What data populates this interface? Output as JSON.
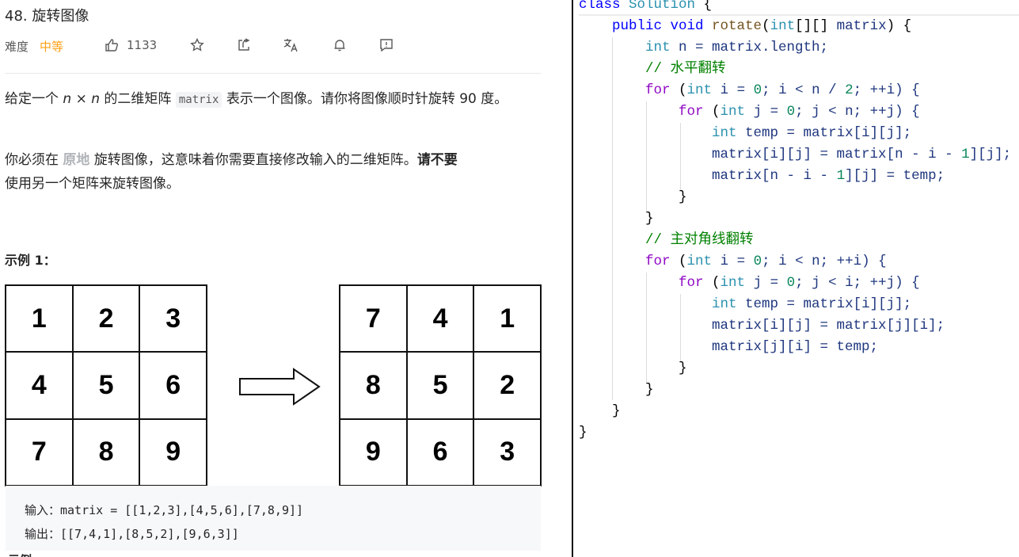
{
  "problem": {
    "title": "48. 旋转图像",
    "difficulty_label": "难度",
    "difficulty": "中等",
    "likes": "1133",
    "icons": [
      "thumbs-up-icon",
      "star-icon",
      "share-icon",
      "translate-icon",
      "bell-icon",
      "feedback-icon"
    ],
    "desc1_a": "给定一个 ",
    "desc1_n1": "n",
    "desc1_x": " × ",
    "desc1_n2": "n",
    "desc1_b": " 的二维矩阵 ",
    "desc1_code": "matrix",
    "desc1_c": " 表示一个图像。请你将图像顺时针旋转 90 度。",
    "desc2_a": "你必须在 ",
    "desc2_link": "原地",
    "desc2_b": " 旋转图像，这意味着你需要直接修改输入的二维矩阵。",
    "desc2_bold": "请不要",
    "desc2_c": "使用另一个矩阵来旋转图像。",
    "example_title": "示例 1：",
    "input_grid": [
      "1",
      "2",
      "3",
      "4",
      "5",
      "6",
      "7",
      "8",
      "9"
    ],
    "output_grid": [
      "7",
      "4",
      "1",
      "8",
      "5",
      "2",
      "9",
      "6",
      "3"
    ],
    "example_input": "输入：matrix = [[1,2,3],[4,5,6],[7,8,9]]",
    "example_output": "输出：[[7,4,1],[8,5,2],[9,6,3]]",
    "next_example_cut": "示例"
  },
  "code_lines": [
    [
      [
        "class ",
        "k"
      ],
      [
        "Solution ",
        "t"
      ],
      [
        "{",
        "pn"
      ]
    ],
    [
      [
        "    public ",
        "k"
      ],
      [
        "void ",
        "k"
      ],
      [
        "rotate",
        "m"
      ],
      [
        "(",
        "pn"
      ],
      [
        "int",
        "t"
      ],
      [
        "[][] ",
        "pn"
      ],
      [
        "matrix",
        ""
      ],
      [
        ") {",
        "pn"
      ]
    ],
    [
      [
        "        int ",
        "t"
      ],
      [
        "n = matrix.length;",
        ""
      ]
    ],
    [
      [
        "        // 水平翻转",
        "c"
      ]
    ],
    [
      [
        "        for ",
        "f"
      ],
      [
        "(",
        "pn"
      ],
      [
        "int ",
        "t"
      ],
      [
        "i = ",
        ""
      ],
      [
        "0",
        "n"
      ],
      [
        "; i < n / ",
        ""
      ],
      [
        "2",
        "n"
      ],
      [
        "; ++i) {",
        ""
      ]
    ],
    [
      [
        "            for ",
        "f"
      ],
      [
        "(",
        "pn"
      ],
      [
        "int ",
        "t"
      ],
      [
        "j = ",
        ""
      ],
      [
        "0",
        "n"
      ],
      [
        "; j < n; ++j) {",
        ""
      ]
    ],
    [
      [
        "                int ",
        "t"
      ],
      [
        "temp = matrix[i][j];",
        ""
      ]
    ],
    [
      [
        "                matrix[i][j] = matrix[n - i - ",
        ""
      ],
      [
        "1",
        "n"
      ],
      [
        "][j];",
        ""
      ]
    ],
    [
      [
        "                matrix[n - i - ",
        ""
      ],
      [
        "1",
        "n"
      ],
      [
        "][j] = temp;",
        ""
      ]
    ],
    [
      [
        "            }",
        "pn"
      ]
    ],
    [
      [
        "        }",
        "pn"
      ]
    ],
    [
      [
        "        // 主对角线翻转",
        "c"
      ]
    ],
    [
      [
        "        for ",
        "f"
      ],
      [
        "(",
        "pn"
      ],
      [
        "int ",
        "t"
      ],
      [
        "i = ",
        ""
      ],
      [
        "0",
        "n"
      ],
      [
        "; i < n; ++i) {",
        ""
      ]
    ],
    [
      [
        "            for ",
        "f"
      ],
      [
        "(",
        "pn"
      ],
      [
        "int ",
        "t"
      ],
      [
        "j = ",
        ""
      ],
      [
        "0",
        "n"
      ],
      [
        "; j < i; ++j) {",
        ""
      ]
    ],
    [
      [
        "                int ",
        "t"
      ],
      [
        "temp = matrix[i][j];",
        ""
      ]
    ],
    [
      [
        "                matrix[i][j] = matrix[j][i];",
        ""
      ]
    ],
    [
      [
        "                matrix[j][i] = temp;",
        ""
      ]
    ],
    [
      [
        "            }",
        "pn"
      ]
    ],
    [
      [
        "        }",
        "pn"
      ]
    ],
    [
      [
        "    }",
        "pn"
      ]
    ],
    [
      [
        "}",
        "pn"
      ]
    ]
  ]
}
